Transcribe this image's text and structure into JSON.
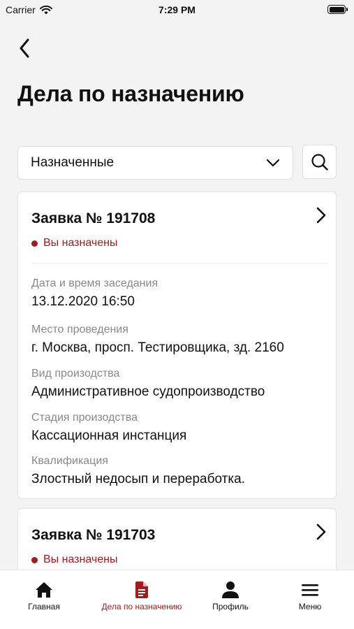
{
  "status_bar": {
    "carrier": "Carrier",
    "time": "7:29 PM"
  },
  "header": {
    "title": "Дела по назначению"
  },
  "filter": {
    "selected": "Назначенные"
  },
  "cards": [
    {
      "title": "Заявка № 191708",
      "status": "Вы назначены",
      "fields": [
        {
          "label": "Дата и время заседания",
          "value": "13.12.2020 16:50"
        },
        {
          "label": "Место проведения",
          "value": "г. Москва, просп. Тестировщика, зд. 2160"
        },
        {
          "label": "Вид произодства",
          "value": "Административное судопроизводство"
        },
        {
          "label": "Стадия произодства",
          "value": "Кассационная инстанция"
        },
        {
          "label": "Квалификация",
          "value": "Злостный недосып и переработка."
        }
      ]
    },
    {
      "title": "Заявка № 191703",
      "status": "Вы назначены"
    }
  ],
  "tab_bar": {
    "tabs": [
      {
        "label": "Главная",
        "icon": "home-icon"
      },
      {
        "label": "Дела по назначению",
        "icon": "document-icon"
      },
      {
        "label": "Профиль",
        "icon": "user-icon"
      },
      {
        "label": "Меню",
        "icon": "menu-icon"
      }
    ],
    "active_index": 1
  },
  "colors": {
    "accent": "#a21c1c",
    "background": "#f3f3f3"
  }
}
